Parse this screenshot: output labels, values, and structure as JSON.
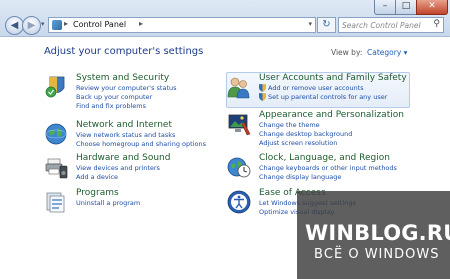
{
  "window": {
    "controls": {
      "minimize": "–",
      "maximize": "□",
      "close": "✕"
    }
  },
  "toolbar": {
    "back_glyph": "◀",
    "forward_glyph": "▶",
    "address": {
      "icon": "control-panel-icon",
      "crumb": "Control Panel",
      "separator": "▸"
    },
    "refresh_glyph": "↻",
    "search": {
      "placeholder": "Search Control Panel",
      "icon": "magnifier-icon"
    }
  },
  "content": {
    "heading": "Adjust your computer's settings",
    "view_by": {
      "label": "View by:",
      "value": "Category ▾"
    },
    "left_column": [
      {
        "title": "System and Security",
        "icon": "system-security-icon",
        "links": [
          "Review your computer's status",
          "Back up your computer",
          "Find and fix problems"
        ]
      },
      {
        "title": "Network and Internet",
        "icon": "network-globe-icon",
        "links": [
          "View network status and tasks",
          "Choose homegroup and sharing options"
        ]
      },
      {
        "title": "Hardware and Sound",
        "icon": "printer-speaker-icon",
        "links": [
          "View devices and printers",
          "Add a device"
        ]
      },
      {
        "title": "Programs",
        "icon": "programs-icon",
        "links": [
          "Uninstall a program"
        ]
      }
    ],
    "right_column": [
      {
        "title": "User Accounts and Family Safety",
        "icon": "users-icon",
        "links": [
          "Add or remove user accounts",
          "Set up parental controls for any user"
        ]
      },
      {
        "title": "Appearance and Personalization",
        "icon": "appearance-icon",
        "links": [
          "Change the theme",
          "Change desktop background",
          "Adjust screen resolution"
        ]
      },
      {
        "title": "Clock, Language, and Region",
        "icon": "clock-globe-icon",
        "links": [
          "Change keyboards or other input methods",
          "Change display language"
        ]
      },
      {
        "title": "Ease of Access",
        "icon": "ease-of-access-icon",
        "links": [
          "Let Windows suggest settings",
          "Optimize visual display"
        ]
      }
    ]
  },
  "watermark": {
    "line1": "WINBLOG.RU",
    "line2": "ВСЁ О WINDOWS"
  }
}
